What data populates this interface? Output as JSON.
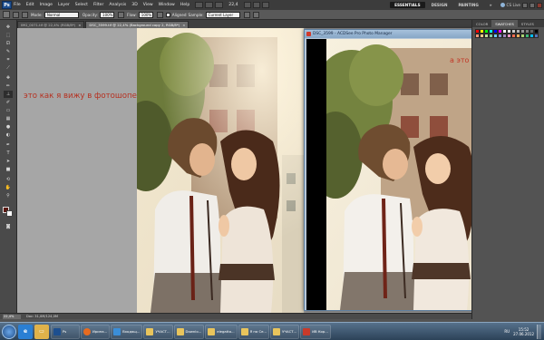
{
  "menubar": {
    "logo": "Ps",
    "items": [
      "File",
      "Edit",
      "Image",
      "Layer",
      "Select",
      "Filter",
      "Analysis",
      "3D",
      "View",
      "Window",
      "Help"
    ],
    "zoom": "22,4",
    "workspaces": [
      "ESSENTIALS",
      "DESIGN",
      "PAINTING",
      "»"
    ],
    "cs_live": "CS Live"
  },
  "options": {
    "mode_label": "Mode:",
    "mode_value": "Normal",
    "opacity_label": "Opacity:",
    "opacity_value": "100%",
    "flow_label": "Flow:",
    "flow_value": "100%",
    "aligned_label": "Aligned",
    "sample_label": "Sample:",
    "sample_value": "Current Layer"
  },
  "tabs": [
    {
      "label": "IMG_0071.tif @ 22,4% (RGB/8*)"
    },
    {
      "label": "DSC_3599.tif @ 22,4% (Background copy 2, RGB/8*)"
    }
  ],
  "canvas": {
    "caption": "это как я вижу в фотошопе"
  },
  "acdsee": {
    "title": "DSC_3599 - ACDSee Pro Photo Manager",
    "caption": "а это тифф"
  },
  "rightdock": {
    "tabs": [
      "COLOR",
      "SWATCHES",
      "STYLES"
    ],
    "swatches": [
      "#ff0000",
      "#ffff00",
      "#00ff00",
      "#00ffff",
      "#0000ff",
      "#ff00ff",
      "#ffffff",
      "#e6e6e6",
      "#cccccc",
      "#b3b3b3",
      "#999999",
      "#808080",
      "#666666",
      "#000000",
      "#f7977a",
      "#fdc68a",
      "#c4df9b",
      "#82ca9d",
      "#6ecff6",
      "#8493ca",
      "#a187be",
      "#f49ac2",
      "#f26c4f",
      "#fbaf5d",
      "#acd372",
      "#3cb878",
      "#00bff3",
      "#5674b9"
    ]
  },
  "status": {
    "zoom": "22,4%",
    "doc_info": "Doc: 31,0M/124,0M"
  },
  "taskbar": {
    "tasks": [
      "Ps",
      "Ирина...",
      "Входящ...",
      "УЧАСТ...",
      "Downlo...",
      "elegatto...",
      "Я на Се...",
      "УЧАСТ...",
      "ИВ Кор..."
    ],
    "lang": "RU",
    "time": "15:52",
    "date": "27.06.2012"
  }
}
